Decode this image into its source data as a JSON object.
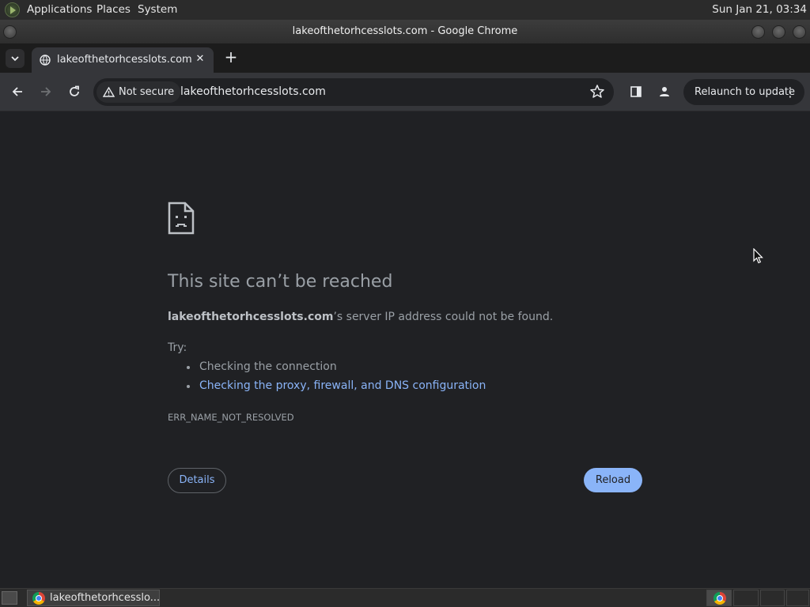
{
  "top_panel": {
    "menus": [
      "Applications",
      "Places",
      "System"
    ],
    "clock": "Sun Jan 21, 03:34"
  },
  "window": {
    "title": "lakeofthetorhcesslots.com - Google Chrome"
  },
  "tab": {
    "title": "lakeofthetorhcesslots.com",
    "close": "✕",
    "new_tab": "+"
  },
  "toolbar": {
    "security_label": "Not secure",
    "url": "lakeofthetorhcesslots.com",
    "relaunch_label": "Relaunch to update"
  },
  "error_page": {
    "title": "This site can’t be reached",
    "host": "lakeofthetorhcesslots.com",
    "description_suffix": "’s server IP address could not be found.",
    "try_label": "Try:",
    "suggestions": [
      {
        "text": "Checking the connection",
        "is_link": false
      },
      {
        "text": "Checking the proxy, firewall, and DNS configuration",
        "is_link": true
      }
    ],
    "error_code": "ERR_NAME_NOT_RESOLVED",
    "details_button": "Details",
    "reload_button": "Reload"
  },
  "taskbar": {
    "task_title": "lakeofthetorhcesslo..."
  },
  "colors": {
    "page_bg": "#202124",
    "toolbar_bg": "#35363a",
    "accent_blue": "#8ab4f8",
    "text_gray": "#9aa0a6"
  }
}
